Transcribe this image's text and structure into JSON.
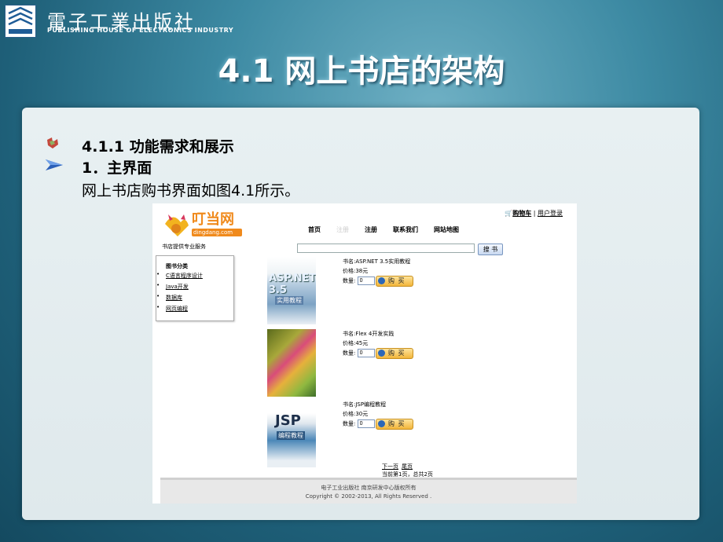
{
  "publisher": {
    "name_cn": "電子工業出版社",
    "name_en": "PUBLISHING HOUSE OF ELECTRONICS INDUSTRY"
  },
  "slide": {
    "title": "4.1  网上书店的架构",
    "section_title": "4.1.1  功能需求和展示",
    "sub_title": "1．主界面",
    "description": "网上书店购书界面如图4.1所示。"
  },
  "screenshot": {
    "site_logo_text": "叮当网",
    "site_logo_sub": "dingdang.com",
    "cart_label": "购物车",
    "user_login_label": "用户登录",
    "nav": [
      "首页",
      "注册",
      "注册",
      "联系我们",
      "网站地图"
    ],
    "tagline": "书店提供专业服务",
    "search_button": "搜 书",
    "category_heading": "图书分类",
    "categories": [
      "C语言程序设计",
      "Java开发",
      "数据库",
      "网页编程"
    ],
    "books": [
      {
        "name": "书名:ASP.NET 3.5实用教程",
        "price": "价格:38元",
        "qty_label": "数量:",
        "qty": "0",
        "buy_label": "购 买",
        "cover_title": "ASP.NET 3.5",
        "cover_sub": "实用教程"
      },
      {
        "name": "书名:Flex 4开发实践",
        "price": "价格:45元",
        "qty_label": "数量:",
        "qty": "0",
        "buy_label": "购 买",
        "cover_title": "",
        "cover_sub": ""
      },
      {
        "name": "书名:JSP编程教程",
        "price": "价格:30元",
        "qty_label": "数量:",
        "qty": "0",
        "buy_label": "购 买",
        "cover_title": "JSP",
        "cover_sub": "编程教程"
      }
    ],
    "pager": {
      "next": "下一页",
      "last": "尾页",
      "status": "当前第1页，总共2页"
    },
    "footer": {
      "line1": "电子工业出版社 南京研发中心版权所有",
      "line2": "Copyright © 2002-2013, All Rights Reserved ."
    }
  },
  "colors": {
    "accent_orange": "#f08a1c",
    "bg_teal": "#3d8aa3"
  }
}
